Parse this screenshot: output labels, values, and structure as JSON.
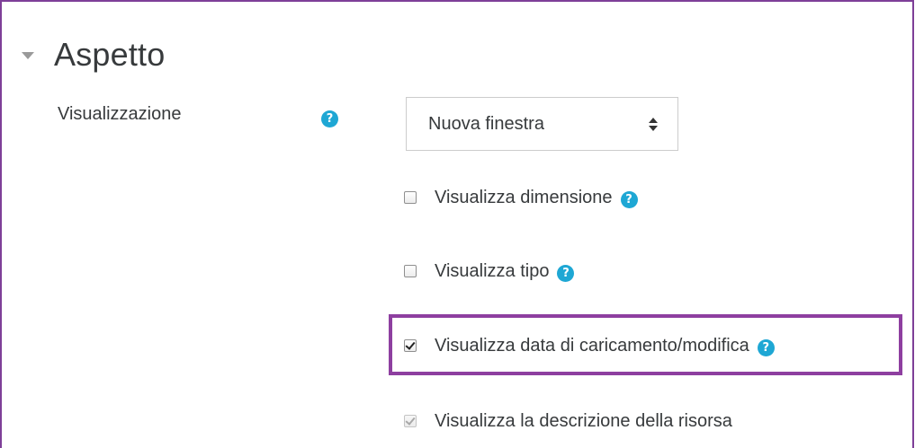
{
  "section": {
    "title": "Aspetto",
    "collapse_icon": "caret-down-icon"
  },
  "display_field": {
    "label": "Visualizzazione",
    "help_icon": "help-icon",
    "select_value": "Nuova finestra"
  },
  "options": [
    {
      "label": "Visualizza dimensione",
      "checked": false,
      "disabled": false,
      "has_help": true
    },
    {
      "label": "Visualizza tipo",
      "checked": false,
      "disabled": false,
      "has_help": true
    },
    {
      "label": "Visualizza data di caricamento/modifica",
      "checked": true,
      "disabled": false,
      "has_help": true,
      "highlighted": true
    },
    {
      "label": "Visualizza la descrizione della risorsa",
      "checked": true,
      "disabled": true,
      "has_help": false
    }
  ],
  "help_glyph": "?",
  "colors": {
    "frame_border": "#7e3f98",
    "highlight_border": "#8e3fa0",
    "help_icon": "#1ea7d4",
    "text": "#373a3c"
  }
}
